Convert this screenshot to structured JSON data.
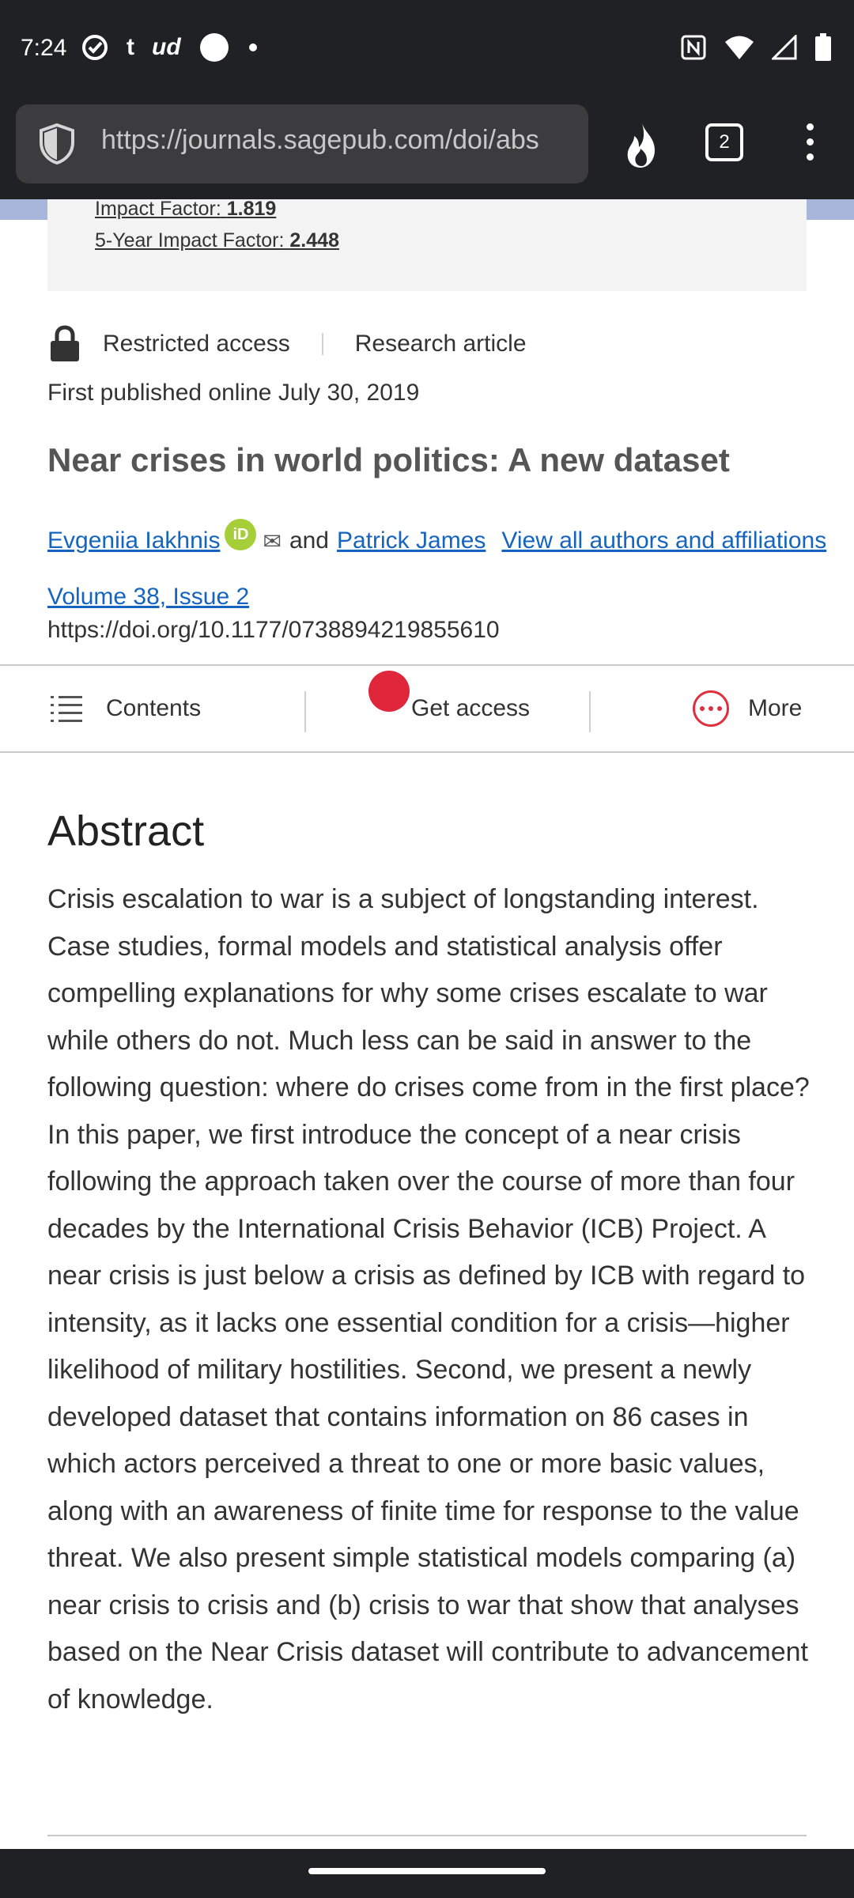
{
  "status_bar": {
    "time": "7:24",
    "left_icons": [
      "check-circle-icon",
      "tumblr-icon",
      "ud-icon",
      "white-circle-icon",
      "dot-icon"
    ],
    "right_icons": [
      "nfc-icon",
      "wifi-icon",
      "signal-icon",
      "battery-icon"
    ]
  },
  "browser": {
    "url": "https://journals.sagepub.com/doi/abs",
    "tab_count": "2",
    "icons": [
      "shield-icon",
      "fire-icon",
      "tabs-icon",
      "overflow-menu-icon"
    ]
  },
  "metrics": {
    "impact_factor_label": "Impact Factor:",
    "impact_factor_value": "1.819",
    "five_year_label": "5-Year Impact Factor:",
    "five_year_value": "2.448"
  },
  "article": {
    "access": "Restricted access",
    "type": "Research article",
    "published": "First published online July 30, 2019",
    "title": "Near crises in world politics: A new dataset",
    "author1": "Evgeniia Iakhnis",
    "orcid_label": "iD",
    "conjunction": "and",
    "author2": "Patrick James",
    "view_all": "View all authors and affiliations",
    "volume": "Volume 38, Issue 2",
    "doi": "https://doi.org/10.1177/0738894219855610"
  },
  "actions": {
    "contents": "Contents",
    "get_access": "Get access",
    "more": "More"
  },
  "abstract": {
    "heading": "Abstract",
    "text": "Crisis escalation to war is a subject of longstanding interest. Case studies, formal models and statistical analysis offer compelling explanations for why some crises escalate to war while others do not. Much less can be said in answer to the following question: where do crises come from in the first place? In this paper, we first introduce the concept of a near crisis following the approach taken over the course of more than four decades by the International Crisis Behavior (ICB) Project. A near crisis is just below a crisis as defined by ICB with regard to intensity, as it lacks one essential condition for a crisis—higher likelihood of military hostilities. Second, we present a newly developed dataset that contains information on 86 cases in which actors perceived a threat to one or more basic values, along with an awareness of finite time for response to the value threat. We also present simple statistical models comparing (a) near crisis to crisis and (b) crisis to war that show that analyses based on the Near Crisis dataset will contribute to advancement of knowledge."
  }
}
